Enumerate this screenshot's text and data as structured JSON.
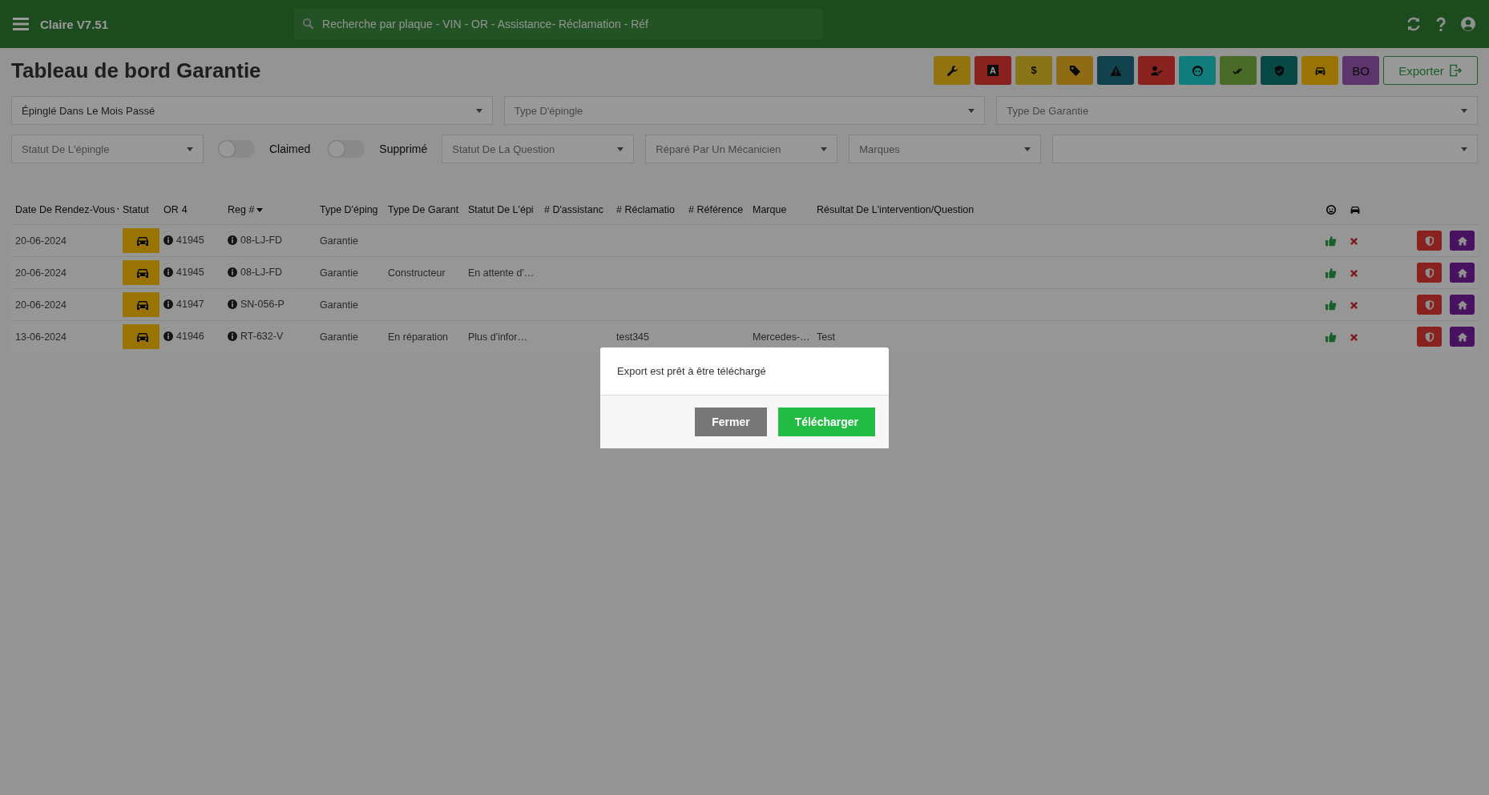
{
  "topbar": {
    "app_title": "Claire V7.51",
    "search": {
      "placeholder": "Recherche par plaque - VIN - OR - Assistance- Réclamation - Réf"
    }
  },
  "page_title": "Tableau de bord Garantie",
  "toolbar": [
    {
      "kind": "wrench"
    },
    {
      "kind": "letter",
      "label": "A"
    },
    {
      "kind": "letter",
      "label": "$"
    },
    {
      "kind": "tag"
    },
    {
      "kind": "warning"
    },
    {
      "kind": "user-check"
    },
    {
      "kind": "face"
    },
    {
      "kind": "double-check"
    },
    {
      "kind": "shield"
    },
    {
      "kind": "car"
    },
    {
      "kind": "text",
      "label": "BO"
    },
    {
      "kind": "export",
      "label": "Exporter"
    }
  ],
  "filters": [
    [
      {
        "kind": "select",
        "value": "Épinglé Dans Le Mois Passé"
      },
      {
        "kind": "select",
        "placeholder": "Type D'épingle"
      },
      {
        "kind": "select",
        "placeholder": "Type De Garantie"
      }
    ],
    [
      {
        "kind": "select",
        "placeholder": "Statut De L'épingle"
      },
      {
        "kind": "toggle",
        "label": "Claimed",
        "on": false
      },
      {
        "kind": "toggle",
        "label": "Supprimé",
        "on": false
      },
      {
        "kind": "select",
        "placeholder": "Statut De La Question"
      },
      {
        "kind": "select",
        "placeholder": "Réparé Par Un Mécanicien"
      },
      {
        "kind": "select",
        "placeholder": "Marques"
      },
      {
        "kind": "select"
      }
    ]
  ],
  "table": {
    "columns": [
      {
        "label": "Date De Rendez-Vous",
        "sortable": true
      },
      {
        "label": "Statut",
        "sortable": false
      },
      {
        "label": "OR",
        "count": "4",
        "sortable": false
      },
      {
        "label": "Reg #",
        "sortable": true
      },
      {
        "label": "Type D'éping",
        "sortable": false
      },
      {
        "label": "Type De Garant",
        "sortable": false
      },
      {
        "label": "Statut De L'épi",
        "sortable": false
      },
      {
        "label": "# D'assistanc",
        "sortable": false
      },
      {
        "label": "# Réclamatio",
        "sortable": false
      },
      {
        "label": "# Référence",
        "sortable": false
      },
      {
        "label": "Marque",
        "sortable": false
      },
      {
        "label": "Résultat De L'intervention/Question",
        "sortable": false
      },
      {
        "kind": "face-icon"
      },
      {
        "kind": "car-icon"
      },
      {
        "kind": "actions"
      }
    ],
    "rows": [
      {
        "date": "20-06-2024",
        "or": "41945",
        "reg": "08-LJ-FD",
        "type_epingle": "Garantie"
      },
      {
        "date": "20-06-2024",
        "or": "41945",
        "reg": "08-LJ-FD",
        "type_epingle": "Garantie",
        "type_garantie": "Constructeur",
        "statut_epingle": "En attente d'…"
      },
      {
        "date": "20-06-2024",
        "or": "41947",
        "reg": "SN-056-P",
        "type_epingle": "Garantie"
      },
      {
        "date": "13-06-2024",
        "or": "41946",
        "reg": "RT-632-V",
        "type_epingle": "Garantie",
        "type_garantie": "En réparation",
        "statut_epingle": "Plus d'infor…",
        "reclamation": "test345",
        "marque": "Mercedes-…",
        "resultat": "Test"
      }
    ]
  },
  "modal": {
    "message": "Export est prêt à être téléchargé",
    "buttons": [
      {
        "label": "Fermer",
        "kind": "secondary"
      },
      {
        "label": "Télécharger",
        "kind": "primary"
      }
    ]
  }
}
